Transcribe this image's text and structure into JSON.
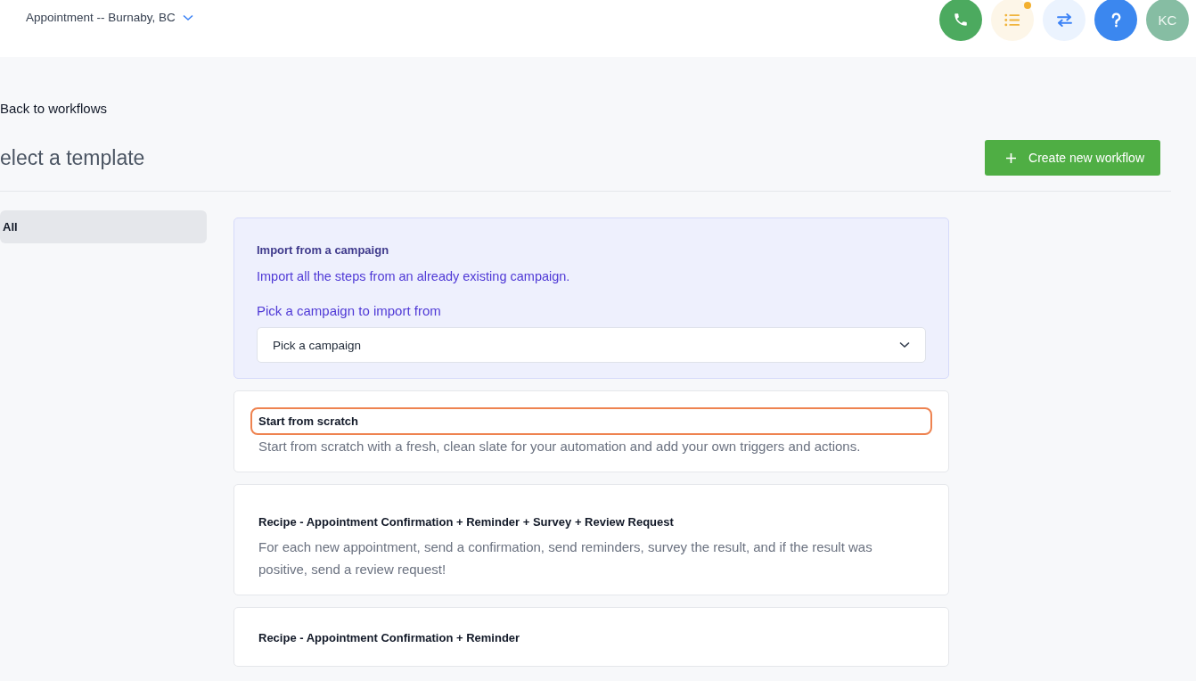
{
  "header": {
    "location": "Appointment -- Burnaby, BC",
    "actions": [
      {
        "kind": "phone"
      },
      {
        "kind": "tasks",
        "notification": true
      },
      {
        "kind": "transfer"
      },
      {
        "kind": "help"
      },
      {
        "kind": "avatar",
        "initials": "KC"
      }
    ]
  },
  "back_link": "Back to workflows",
  "page_title": "elect a template",
  "create_button": "Create new workflow",
  "sidebar": {
    "items": [
      {
        "label": "All",
        "selected": true
      }
    ]
  },
  "import_card": {
    "title": "Import from a campaign",
    "description": "Import all the steps from an already existing campaign.",
    "select_label": "Pick a campaign to import from",
    "select_value": "Pick a campaign"
  },
  "templates": [
    {
      "title": "Start from scratch",
      "focused": true,
      "description": "Start from scratch with a fresh, clean slate for your automation and add your own triggers and actions."
    },
    {
      "title": "Recipe - Appointment Confirmation + Reminder + Survey + Review Request",
      "focused": false,
      "description": "For each new appointment, send a confirmation, send reminders, survey the result, and if the result was positive, send a review request!"
    },
    {
      "title": "Recipe - Appointment Confirmation + Reminder",
      "focused": false
    }
  ]
}
